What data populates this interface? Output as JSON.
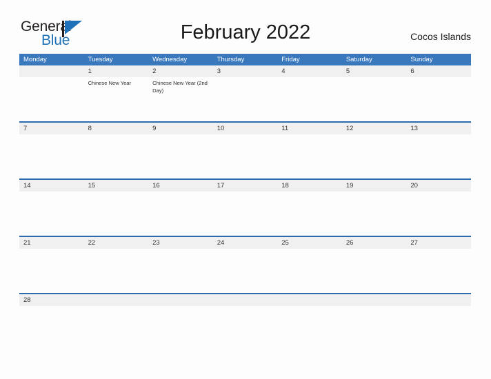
{
  "brand": {
    "name_part1": "General",
    "name_part2": "Blue",
    "flag_icon": "blue-flag-triangle-icon",
    "accent_color": "#1f72b8"
  },
  "header": {
    "title": "February 2022",
    "location": "Cocos Islands"
  },
  "colors": {
    "header_blue": "#3a78bd",
    "rule_blue": "#2a6cac",
    "number_band_gray": "#f0f0f0",
    "page_background": "#fdfdfd"
  },
  "calendar": {
    "weekdays": [
      "Monday",
      "Tuesday",
      "Wednesday",
      "Thursday",
      "Friday",
      "Saturday",
      "Sunday"
    ],
    "weeks": [
      {
        "days": [
          {
            "number": "",
            "events": []
          },
          {
            "number": "1",
            "events": [
              "Chinese New Year"
            ]
          },
          {
            "number": "2",
            "events": [
              "Chinese New Year (2nd Day)"
            ]
          },
          {
            "number": "3",
            "events": []
          },
          {
            "number": "4",
            "events": []
          },
          {
            "number": "5",
            "events": []
          },
          {
            "number": "6",
            "events": []
          }
        ]
      },
      {
        "days": [
          {
            "number": "7",
            "events": []
          },
          {
            "number": "8",
            "events": []
          },
          {
            "number": "9",
            "events": []
          },
          {
            "number": "10",
            "events": []
          },
          {
            "number": "11",
            "events": []
          },
          {
            "number": "12",
            "events": []
          },
          {
            "number": "13",
            "events": []
          }
        ]
      },
      {
        "days": [
          {
            "number": "14",
            "events": []
          },
          {
            "number": "15",
            "events": []
          },
          {
            "number": "16",
            "events": []
          },
          {
            "number": "17",
            "events": []
          },
          {
            "number": "18",
            "events": []
          },
          {
            "number": "19",
            "events": []
          },
          {
            "number": "20",
            "events": []
          }
        ]
      },
      {
        "days": [
          {
            "number": "21",
            "events": []
          },
          {
            "number": "22",
            "events": []
          },
          {
            "number": "23",
            "events": []
          },
          {
            "number": "24",
            "events": []
          },
          {
            "number": "25",
            "events": []
          },
          {
            "number": "26",
            "events": []
          },
          {
            "number": "27",
            "events": []
          }
        ]
      },
      {
        "days": [
          {
            "number": "28",
            "events": []
          },
          {
            "number": "",
            "events": []
          },
          {
            "number": "",
            "events": []
          },
          {
            "number": "",
            "events": []
          },
          {
            "number": "",
            "events": []
          },
          {
            "number": "",
            "events": []
          },
          {
            "number": "",
            "events": []
          }
        ]
      }
    ]
  }
}
